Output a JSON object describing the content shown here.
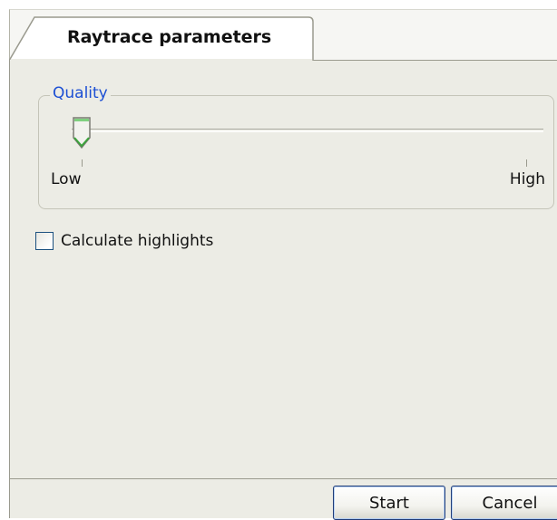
{
  "tabs": [
    {
      "label": "Raytrace parameters",
      "selected": true
    }
  ],
  "quality_group": {
    "legend": "Quality",
    "slider": {
      "min_label": "Low",
      "max_label": "High",
      "level": 0
    }
  },
  "options": {
    "calculate_highlights": {
      "label": "Calculate highlights",
      "checked": false
    }
  },
  "buttons": {
    "start_label": "Start",
    "cancel_label": "Cancel"
  },
  "colors": {
    "group_legend": "#1c4fd4",
    "panel_background": "#ecece5",
    "slider_thumb_accent": "#3aa33a"
  }
}
